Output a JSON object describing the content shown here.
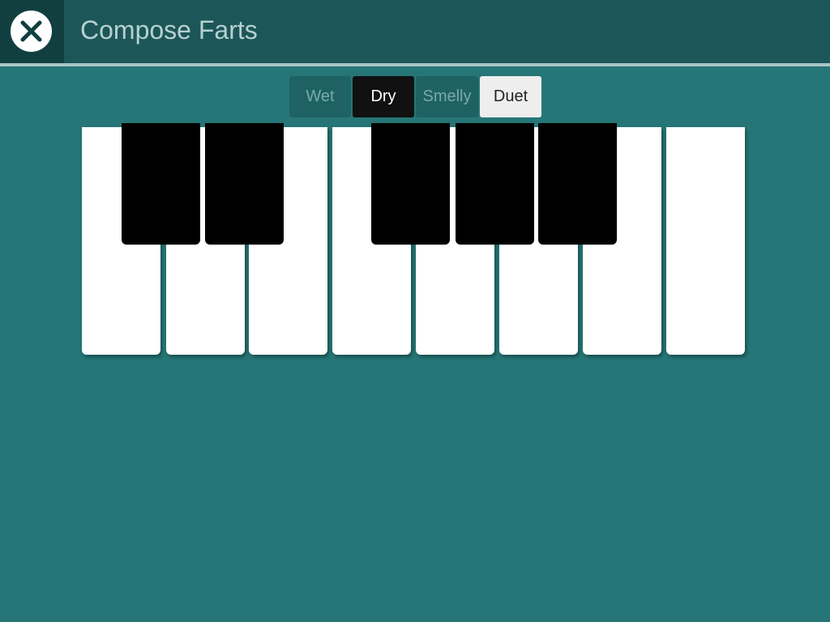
{
  "header": {
    "title": "Compose Farts",
    "close_icon": "close-x-icon"
  },
  "tabs": [
    {
      "label": "Wet",
      "state": "inactive"
    },
    {
      "label": "Dry",
      "state": "selected"
    },
    {
      "label": "Smelly",
      "state": "inactive"
    },
    {
      "label": "Duet",
      "state": "highlighted"
    }
  ],
  "keyboard": {
    "white_keys": 8,
    "black_keys": 5
  },
  "colors": {
    "background": "#267677",
    "header": "#1c5658",
    "close_area": "#113f40",
    "title_text": "#b6d0d0"
  }
}
